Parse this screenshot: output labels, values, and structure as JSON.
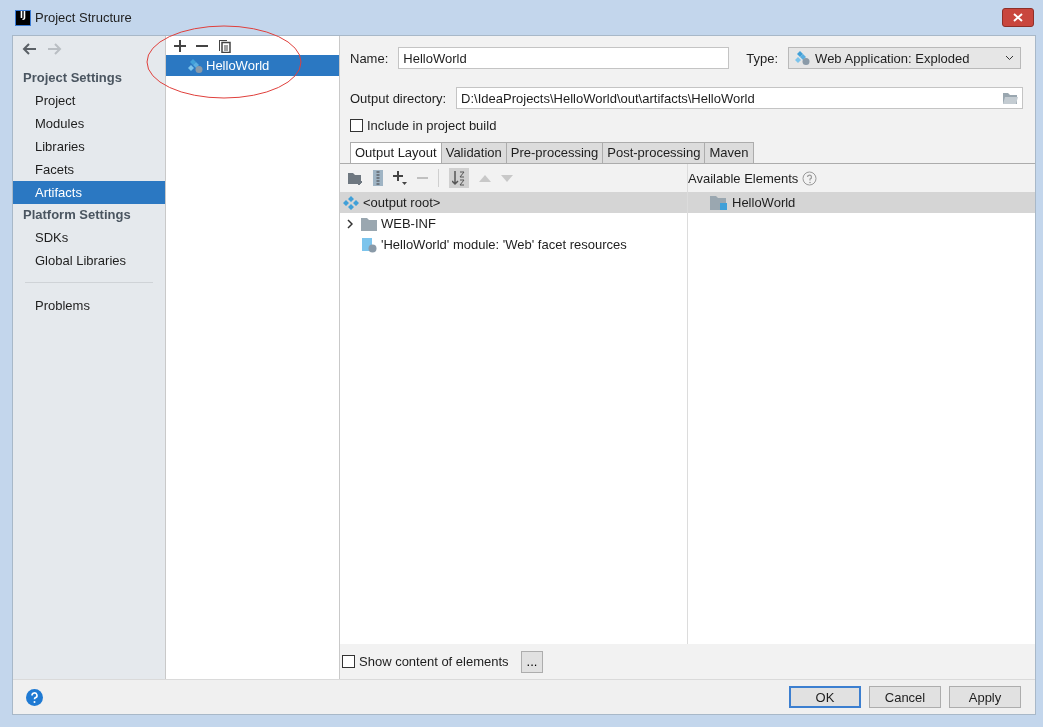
{
  "window": {
    "title": "Project Structure",
    "app_icon": "IJ"
  },
  "nav": [
    {
      "kind": "back",
      "disabled": false
    },
    {
      "kind": "forward",
      "disabled": true
    }
  ],
  "sidebar": {
    "sections": [
      {
        "heading": "Project Settings",
        "items": [
          {
            "label": "Project",
            "selected": false
          },
          {
            "label": "Modules",
            "selected": false
          },
          {
            "label": "Libraries",
            "selected": false
          },
          {
            "label": "Facets",
            "selected": false
          },
          {
            "label": "Artifacts",
            "selected": true
          }
        ]
      },
      {
        "heading": "Platform Settings",
        "items": [
          {
            "label": "SDKs",
            "selected": false
          },
          {
            "label": "Global Libraries",
            "selected": false
          }
        ]
      },
      {
        "items": [
          {
            "label": "Problems",
            "selected": false
          }
        ]
      }
    ]
  },
  "artifacts": {
    "items": [
      {
        "label": "HelloWorld",
        "selected": true
      }
    ]
  },
  "annotation": {
    "kind": "ellipse"
  },
  "editor": {
    "name_label": "Name:",
    "name_value": "HelloWorld",
    "type_label": "Type:",
    "type_value": "Web Application: Exploded",
    "output_label": "Output directory:",
    "output_value": "D:\\IdeaProjects\\HelloWorld\\out\\artifacts\\HelloWorld",
    "include_build": {
      "label": "Include in project build",
      "checked": false
    },
    "tabs": [
      {
        "label": "Output Layout",
        "selected": true
      },
      {
        "label": "Validation",
        "selected": false
      },
      {
        "label": "Pre-processing",
        "selected": false
      },
      {
        "label": "Post-processing",
        "selected": false
      },
      {
        "label": "Maven",
        "selected": false
      }
    ],
    "layout_tree": [
      {
        "label": "<output root>",
        "kind": "root",
        "selected": true,
        "children": [
          {
            "label": "WEB-INF",
            "kind": "folder",
            "selected": false,
            "expanded": false
          },
          {
            "label": "'HelloWorld' module: 'Web' facet resources",
            "kind": "facet",
            "selected": false
          }
        ]
      }
    ],
    "available": {
      "label": "Available Elements",
      "items": [
        {
          "label": "HelloWorld",
          "kind": "module",
          "selected": true
        }
      ]
    },
    "show_content": {
      "label": "Show content of elements",
      "checked": false
    },
    "more_button": "..."
  },
  "footer": {
    "buttons": [
      {
        "label": "OK",
        "default": true
      },
      {
        "label": "Cancel",
        "default": false
      },
      {
        "label": "Apply",
        "default": false
      }
    ]
  }
}
